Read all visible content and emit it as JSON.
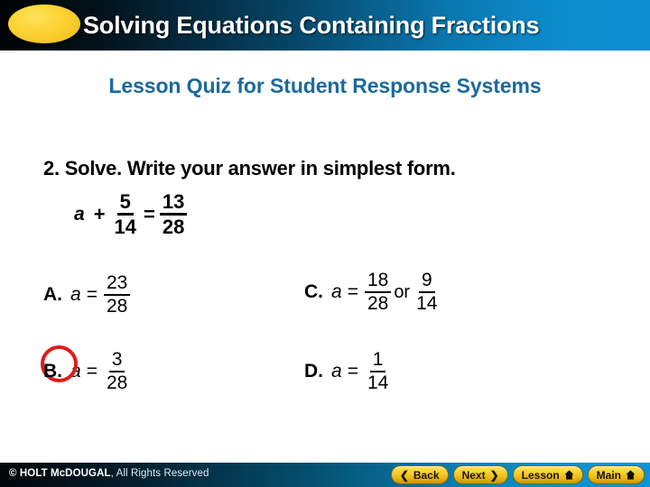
{
  "header": {
    "title": "Solving Equations Containing Fractions",
    "ellipse_icon": "yellow-ellipse-decoration",
    "gradient_dark": "#000305",
    "gradient_light": "#0d8ed0"
  },
  "subtitle": {
    "text": "Lesson Quiz for Student Response Systems",
    "color": "#1a6a9f"
  },
  "question": {
    "prompt": "2. Solve. Write your answer in simplest form.",
    "equation": {
      "variable": "a",
      "operator": "+",
      "left_fraction": {
        "numerator": "5",
        "denominator": "14"
      },
      "equals": "=",
      "right_fraction": {
        "numerator": "13",
        "denominator": "28"
      }
    }
  },
  "choices": [
    {
      "letter": "A.",
      "variable": "a",
      "equals": "=",
      "fraction": {
        "numerator": "23",
        "denominator": "28"
      },
      "selected": false
    },
    {
      "letter": "B.",
      "variable": "a",
      "equals": "=",
      "fraction": {
        "numerator": "3",
        "denominator": "28"
      },
      "selected": true,
      "highlight_color": "#e01b1b"
    },
    {
      "letter": "C.",
      "variable": "a",
      "equals": "=",
      "fraction": {
        "numerator": "18",
        "denominator": "28"
      },
      "or_word": "or",
      "fraction2": {
        "numerator": "9",
        "denominator": "14"
      },
      "selected": false
    },
    {
      "letter": "D.",
      "variable": "a",
      "equals": "=",
      "fraction": {
        "numerator": "1",
        "denominator": "14"
      },
      "selected": false
    }
  ],
  "footer": {
    "copyright_mark": "© HOLT McDOUGAL",
    "copyright_rest": ", All Rights Reserved",
    "buttons": [
      {
        "label": "Back",
        "icon": "chevron-left-icon",
        "glyph": "❮"
      },
      {
        "label": "Next",
        "icon": "chevron-right-icon",
        "glyph": "❯"
      },
      {
        "label": "Lesson",
        "icon": "home-icon"
      },
      {
        "label": "Main",
        "icon": "home-icon"
      }
    ]
  }
}
